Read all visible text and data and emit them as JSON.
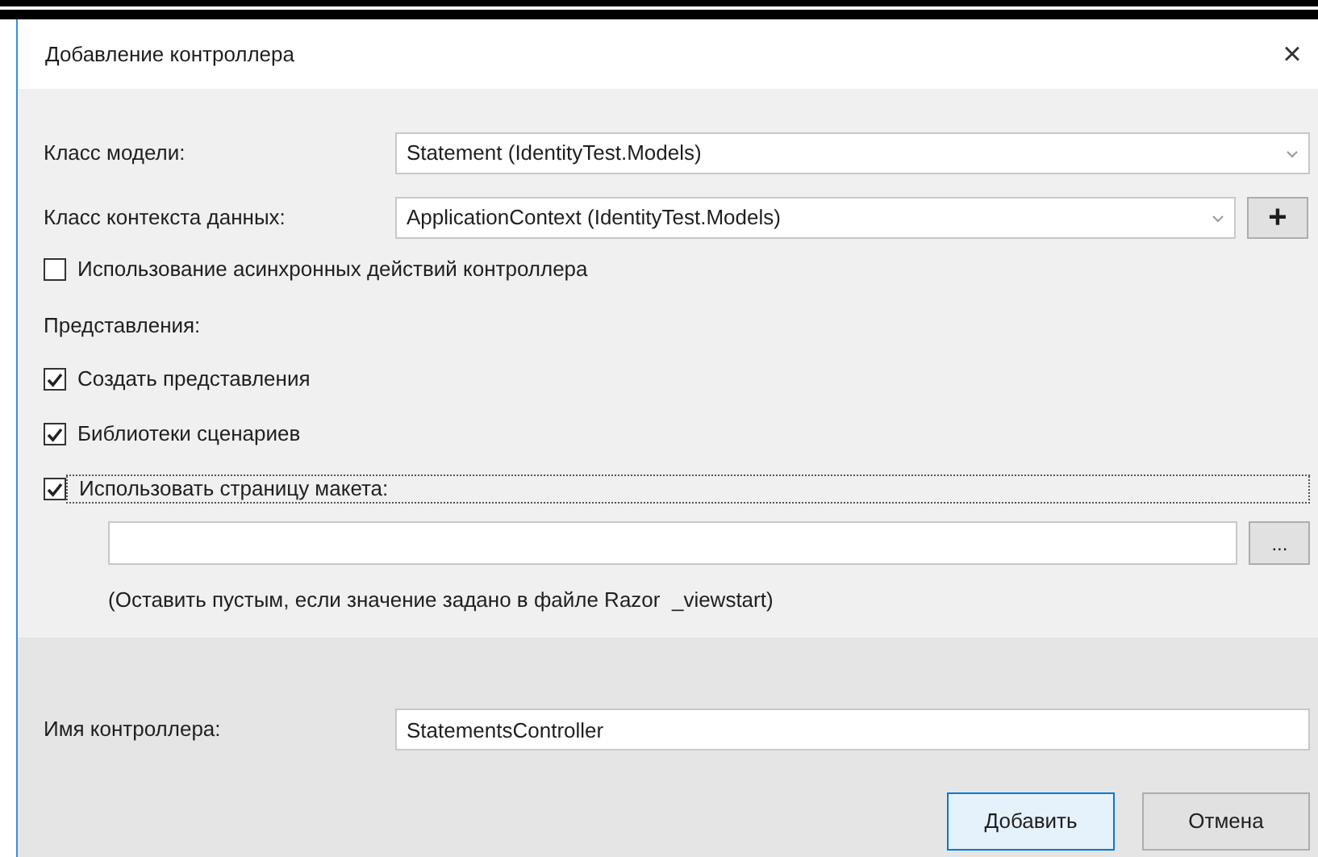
{
  "window": {
    "title": "Добавление контроллера",
    "close": "×"
  },
  "model_class": {
    "label": "Класс модели:",
    "value": "Statement (IdentityTest.Models)"
  },
  "context_class": {
    "label": "Класс контекста данных:",
    "value": "ApplicationContext (IdentityTest.Models)",
    "add_button": "+"
  },
  "async_option": {
    "label": "Использование асинхронных действий контроллера",
    "checked": false
  },
  "views": {
    "heading": "Представления:",
    "options": [
      {
        "label": "Создать представления",
        "checked": true,
        "focused": false
      },
      {
        "label": "Библиотеки сценариев",
        "checked": true,
        "focused": false
      },
      {
        "label": "Использовать страницу макета:",
        "checked": true,
        "focused": true
      }
    ]
  },
  "layout_page": {
    "browse_button": "...",
    "hint": "(Оставить пустым, если значение задано в файле Razor  _viewstart)"
  },
  "controller_name": {
    "label": "Имя контроллера:",
    "value": "StatementsController"
  },
  "buttons": [
    {
      "label": "Добавить",
      "default": true
    },
    {
      "label": "Отмена",
      "default": false
    }
  ]
}
